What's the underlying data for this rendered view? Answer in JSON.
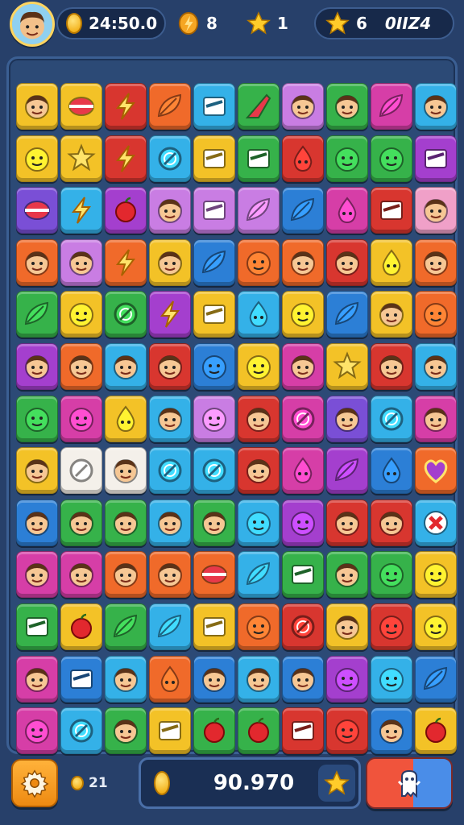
{
  "hud": {
    "avatar_icon": "player-avatar",
    "coins_value": "24:50.0",
    "bolt_value": "8",
    "star_value": "1",
    "star2_value": "6",
    "star2_extra": "0IIZ4"
  },
  "board": {
    "rows": [
      [
        {
          "c": "#f3c227",
          "i": "face"
        },
        {
          "c": "#f3c227",
          "i": "ball"
        },
        {
          "c": "#d8362f",
          "i": "bolt"
        },
        {
          "c": "#f06a2a",
          "i": "leaf"
        },
        {
          "c": "#34b1e8",
          "i": "square"
        },
        {
          "c": "#36b24a",
          "i": "arrow"
        },
        {
          "c": "#c97de3",
          "i": "face"
        },
        {
          "c": "#36b24a",
          "i": "face"
        },
        {
          "c": "#d63ea7",
          "i": "leaf"
        },
        {
          "c": "#34b1e8",
          "i": "face"
        }
      ],
      [
        {
          "c": "#f3c227",
          "i": "blob"
        },
        {
          "c": "#f3c227",
          "i": "star"
        },
        {
          "c": "#d8362f",
          "i": "bolt"
        },
        {
          "c": "#34b1e8",
          "i": "ring"
        },
        {
          "c": "#f3c227",
          "i": "square"
        },
        {
          "c": "#36b24a",
          "i": "square"
        },
        {
          "c": "#d8362f",
          "i": "drop"
        },
        {
          "c": "#36b24a",
          "i": "blob"
        },
        {
          "c": "#36b24a",
          "i": "blob"
        },
        {
          "c": "#a43fce",
          "i": "square"
        }
      ],
      [
        {
          "c": "#7a4fd6",
          "i": "ball"
        },
        {
          "c": "#34b1e8",
          "i": "bolt"
        },
        {
          "c": "#a43fce",
          "i": "apple"
        },
        {
          "c": "#c97de3",
          "i": "face"
        },
        {
          "c": "#c97de3",
          "i": "square"
        },
        {
          "c": "#c97de3",
          "i": "leaf"
        },
        {
          "c": "#2c7fd6",
          "i": "leaf"
        },
        {
          "c": "#d63ea7",
          "i": "drop"
        },
        {
          "c": "#d8362f",
          "i": "square"
        },
        {
          "c": "#f0a0c8",
          "i": "face"
        }
      ],
      [
        {
          "c": "#f06a2a",
          "i": "face"
        },
        {
          "c": "#c97de3",
          "i": "face"
        },
        {
          "c": "#f06a2a",
          "i": "bolt"
        },
        {
          "c": "#f3c227",
          "i": "face"
        },
        {
          "c": "#2c7fd6",
          "i": "leaf"
        },
        {
          "c": "#f06a2a",
          "i": "blob"
        },
        {
          "c": "#f06a2a",
          "i": "face"
        },
        {
          "c": "#d8362f",
          "i": "face"
        },
        {
          "c": "#f3c227",
          "i": "drop"
        },
        {
          "c": "#f06a2a",
          "i": "face"
        }
      ],
      [
        {
          "c": "#36b24a",
          "i": "leaf"
        },
        {
          "c": "#f3c227",
          "i": "blob"
        },
        {
          "c": "#36b24a",
          "i": "ring"
        },
        {
          "c": "#a43fce",
          "i": "bolt"
        },
        {
          "c": "#f3c227",
          "i": "square"
        },
        {
          "c": "#34b1e8",
          "i": "drop"
        },
        {
          "c": "#f3c227",
          "i": "blob"
        },
        {
          "c": "#2c7fd6",
          "i": "leaf"
        },
        {
          "c": "#f3c227",
          "i": "face"
        },
        {
          "c": "#f06a2a",
          "i": "blob"
        }
      ],
      [
        {
          "c": "#a43fce",
          "i": "face"
        },
        {
          "c": "#f06a2a",
          "i": "face"
        },
        {
          "c": "#34b1e8",
          "i": "face"
        },
        {
          "c": "#d8362f",
          "i": "face"
        },
        {
          "c": "#2c7fd6",
          "i": "blob"
        },
        {
          "c": "#f3c227",
          "i": "blob"
        },
        {
          "c": "#d63ea7",
          "i": "face"
        },
        {
          "c": "#f3c227",
          "i": "star"
        },
        {
          "c": "#d8362f",
          "i": "face"
        },
        {
          "c": "#34b1e8",
          "i": "face"
        }
      ],
      [
        {
          "c": "#36b24a",
          "i": "blob"
        },
        {
          "c": "#d63ea7",
          "i": "blob"
        },
        {
          "c": "#f3c227",
          "i": "drop"
        },
        {
          "c": "#34b1e8",
          "i": "face"
        },
        {
          "c": "#c97de3",
          "i": "blob"
        },
        {
          "c": "#d8362f",
          "i": "face"
        },
        {
          "c": "#d63ea7",
          "i": "ring"
        },
        {
          "c": "#7a4fd6",
          "i": "face"
        },
        {
          "c": "#34b1e8",
          "i": "ring"
        },
        {
          "c": "#d63ea7",
          "i": "face"
        }
      ],
      [
        {
          "c": "#f3c227",
          "i": "face"
        },
        {
          "c": "#f4f0ea",
          "i": "ring"
        },
        {
          "c": "#f4f0ea",
          "i": "face"
        },
        {
          "c": "#34b1e8",
          "i": "ring"
        },
        {
          "c": "#34b1e8",
          "i": "ring"
        },
        {
          "c": "#d8362f",
          "i": "face"
        },
        {
          "c": "#d63ea7",
          "i": "drop"
        },
        {
          "c": "#a43fce",
          "i": "leaf"
        },
        {
          "c": "#2c7fd6",
          "i": "drop"
        },
        {
          "c": "#f06a2a",
          "i": "heart"
        }
      ],
      [
        {
          "c": "#2c7fd6",
          "i": "face"
        },
        {
          "c": "#36b24a",
          "i": "face"
        },
        {
          "c": "#36b24a",
          "i": "face"
        },
        {
          "c": "#34b1e8",
          "i": "face"
        },
        {
          "c": "#36b24a",
          "i": "face"
        },
        {
          "c": "#34b1e8",
          "i": "blob"
        },
        {
          "c": "#a43fce",
          "i": "blob"
        },
        {
          "c": "#d8362f",
          "i": "face"
        },
        {
          "c": "#d8362f",
          "i": "face"
        },
        {
          "c": "#34b1e8",
          "i": "cross"
        }
      ],
      [
        {
          "c": "#d63ea7",
          "i": "face"
        },
        {
          "c": "#d63ea7",
          "i": "face"
        },
        {
          "c": "#f06a2a",
          "i": "face"
        },
        {
          "c": "#f06a2a",
          "i": "face"
        },
        {
          "c": "#f06a2a",
          "i": "ball"
        },
        {
          "c": "#34b1e8",
          "i": "leaf"
        },
        {
          "c": "#36b24a",
          "i": "square"
        },
        {
          "c": "#36b24a",
          "i": "face"
        },
        {
          "c": "#36b24a",
          "i": "blob"
        },
        {
          "c": "#f3c227",
          "i": "blob"
        }
      ],
      [
        {
          "c": "#36b24a",
          "i": "square"
        },
        {
          "c": "#f3c227",
          "i": "apple"
        },
        {
          "c": "#36b24a",
          "i": "leaf"
        },
        {
          "c": "#34b1e8",
          "i": "leaf"
        },
        {
          "c": "#f3c227",
          "i": "square"
        },
        {
          "c": "#f06a2a",
          "i": "blob"
        },
        {
          "c": "#d8362f",
          "i": "ring"
        },
        {
          "c": "#f3c227",
          "i": "face"
        },
        {
          "c": "#d8362f",
          "i": "blob"
        },
        {
          "c": "#f3c227",
          "i": "blob"
        }
      ],
      [
        {
          "c": "#d63ea7",
          "i": "face"
        },
        {
          "c": "#2c7fd6",
          "i": "square"
        },
        {
          "c": "#34b1e8",
          "i": "face"
        },
        {
          "c": "#f06a2a",
          "i": "drop"
        },
        {
          "c": "#2c7fd6",
          "i": "face"
        },
        {
          "c": "#34b1e8",
          "i": "face"
        },
        {
          "c": "#2c7fd6",
          "i": "face"
        },
        {
          "c": "#a43fce",
          "i": "blob"
        },
        {
          "c": "#34b1e8",
          "i": "blob"
        },
        {
          "c": "#2c7fd6",
          "i": "leaf"
        }
      ],
      [
        {
          "c": "#d63ea7",
          "i": "blob"
        },
        {
          "c": "#34b1e8",
          "i": "ring"
        },
        {
          "c": "#36b24a",
          "i": "face"
        },
        {
          "c": "#f3c227",
          "i": "square"
        },
        {
          "c": "#36b24a",
          "i": "apple"
        },
        {
          "c": "#36b24a",
          "i": "apple"
        },
        {
          "c": "#d8362f",
          "i": "square"
        },
        {
          "c": "#d8362f",
          "i": "blob"
        },
        {
          "c": "#2c7fd6",
          "i": "face"
        },
        {
          "c": "#f3c227",
          "i": "apple"
        }
      ]
    ]
  },
  "footer": {
    "settings_icon": "gear-icon",
    "moves_value": "21",
    "score_value": "90.970",
    "booster_icon": "booster-icon"
  }
}
